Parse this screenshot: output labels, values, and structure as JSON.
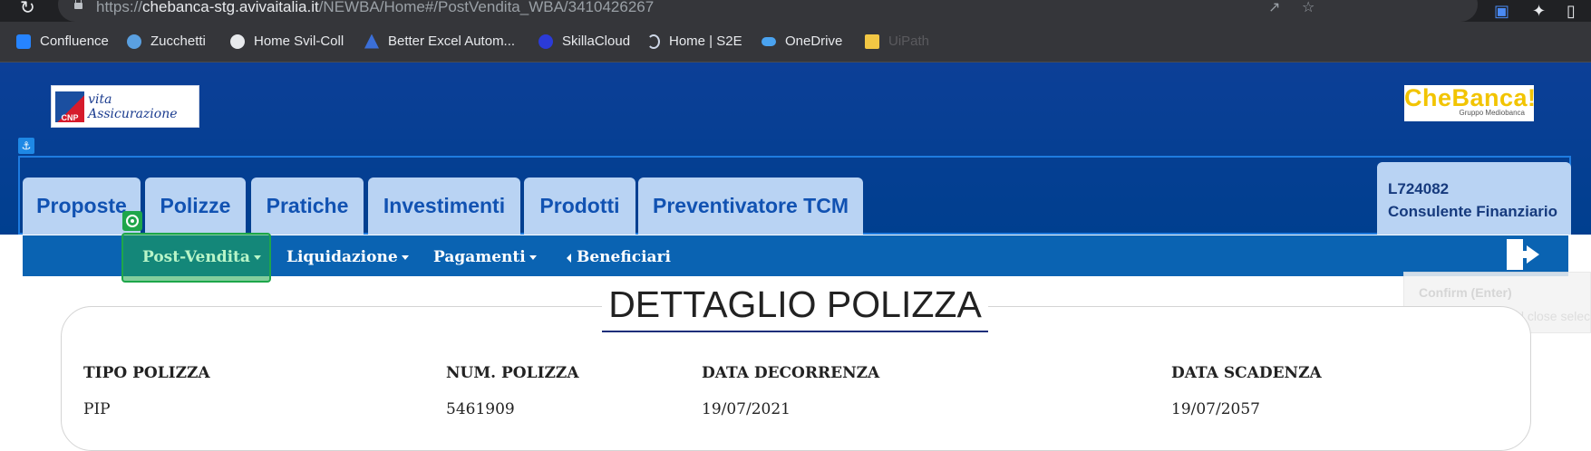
{
  "browser": {
    "url_prefix": "https://",
    "url_host": "chebanca-stg.avivaitalia.it",
    "url_path": "/NEWBA/Home#/PostVendita_WBA/3410426267",
    "bookmarks": [
      {
        "label": "Confluence",
        "icon": "confluence-icon",
        "color": "#2684ff"
      },
      {
        "label": "Zucchetti",
        "icon": "zucchetti-icon",
        "color": "#5aa0e0"
      },
      {
        "label": "Home Svil-Coll",
        "icon": "globe-icon",
        "color": "#e8eaed"
      },
      {
        "label": "Better Excel Autom...",
        "icon": "better-excel-icon",
        "color": "#3b6fd8"
      },
      {
        "label": "SkillaCloud",
        "icon": "skillacloud-icon",
        "color": "#2b3bd8"
      },
      {
        "label": "Home | S2E",
        "icon": "s2e-icon",
        "color": "#cfd8e8"
      },
      {
        "label": "OneDrive",
        "icon": "onedrive-icon",
        "color": "#4aa3f0"
      },
      {
        "label": "UiPath",
        "icon": "folder-icon",
        "color": "#f2c744"
      }
    ]
  },
  "header": {
    "left_logo_brand": "CNP",
    "left_logo_text": "vita Assicurazione",
    "right_logo_main": "CheBanca!",
    "right_logo_sub": "Gruppo Mediobanca"
  },
  "tabs": [
    {
      "label": "Proposte"
    },
    {
      "label": "Polizze"
    },
    {
      "label": "Pratiche"
    },
    {
      "label": "Investimenti"
    },
    {
      "label": "Prodotti"
    },
    {
      "label": "Preventivatore TCM"
    }
  ],
  "user": {
    "code": "L724082",
    "role": "Consulente Finanziario"
  },
  "subnav": {
    "post_vendita": "Post-Vendita",
    "liquidazione": "Liquidazione",
    "pagamenti": "Pagamenti",
    "beneficiari": "Beneficiari"
  },
  "tooltip": {
    "title": "Confirm (Enter)",
    "body": "Save changes and close selec"
  },
  "detail": {
    "title": "DETTAGLIO POLIZZA",
    "fields": [
      {
        "label": "TIPO POLIZZA",
        "value": "PIP"
      },
      {
        "label": "NUM. POLIZZA",
        "value": "5461909"
      },
      {
        "label": "DATA DECORRENZA",
        "value": "19/07/2021"
      },
      {
        "label": "DATA SCADENZA",
        "value": "19/07/2057"
      }
    ]
  },
  "colors": {
    "header_blue": "#003f8f",
    "tab_bg": "#b9d3f3",
    "subnav_bg": "#0a63b2",
    "highlight_green": "#1ea64a",
    "chebanca_yellow": "#f2c400"
  }
}
